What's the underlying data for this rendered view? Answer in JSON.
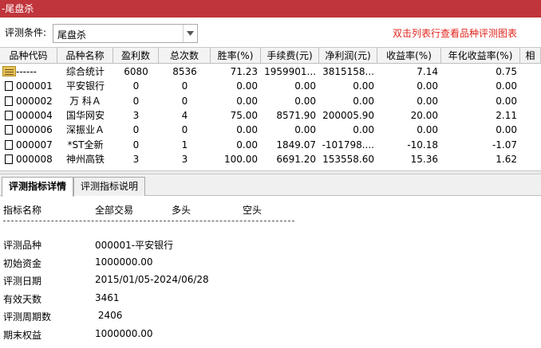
{
  "window": {
    "title": "-尾盘杀"
  },
  "toolbar": {
    "condition_label": "评测条件:",
    "condition_value": "尾盘杀",
    "hint": "双击列表行查看品种评测图表"
  },
  "table": {
    "columns": [
      "品种代码",
      "品种名称",
      "盈利数",
      "总次数",
      "胜率(%)",
      "手续费(元)",
      "净利润(元)",
      "收益率(%)",
      "年化收益率(%)",
      "相"
    ],
    "rows": [
      {
        "code": "------",
        "name": "综合统计",
        "wins": "6080",
        "total": "8536",
        "winrate": "71.23",
        "fee": "1959901...",
        "profit": "3815158...",
        "ret": "7.14",
        "annual": "0.75",
        "summary": true
      },
      {
        "code": "000001",
        "name": "平安银行",
        "wins": "0",
        "total": "0",
        "winrate": "0.00",
        "fee": "0.00",
        "profit": "0.00",
        "ret": "0.00",
        "annual": "0.00"
      },
      {
        "code": "000002",
        "name": "万 科Ａ",
        "wins": "0",
        "total": "0",
        "winrate": "0.00",
        "fee": "0.00",
        "profit": "0.00",
        "ret": "0.00",
        "annual": "0.00"
      },
      {
        "code": "000004",
        "name": "国华网安",
        "wins": "3",
        "total": "4",
        "winrate": "75.00",
        "fee": "8571.90",
        "profit": "200005.90",
        "ret": "20.00",
        "annual": "2.11"
      },
      {
        "code": "000006",
        "name": "深振业Ａ",
        "wins": "0",
        "total": "0",
        "winrate": "0.00",
        "fee": "0.00",
        "profit": "0.00",
        "ret": "0.00",
        "annual": "0.00"
      },
      {
        "code": "000007",
        "name": "*ST全新",
        "wins": "0",
        "total": "1",
        "winrate": "0.00",
        "fee": "1849.07",
        "profit": "-101798....",
        "ret": "-10.18",
        "annual": "-1.07"
      },
      {
        "code": "000008",
        "name": "神州高铁",
        "wins": "3",
        "total": "3",
        "winrate": "100.00",
        "fee": "6691.20",
        "profit": "153558.60",
        "ret": "15.36",
        "annual": "1.62"
      }
    ]
  },
  "tabs": [
    {
      "label": "评测指标详情",
      "active": true
    },
    {
      "label": "评测指标说明",
      "active": false
    }
  ],
  "detail": {
    "headers": [
      "指标名称",
      "全部交易",
      "多头",
      "空头"
    ],
    "rows": [
      {
        "label": "评测品种",
        "value": "000001-平安银行"
      },
      {
        "label": "初始资金",
        "value": "1000000.00"
      },
      {
        "label": "评测日期",
        "value": "2015/01/05-2024/06/28"
      },
      {
        "label": "有效天数",
        "value": "3461"
      },
      {
        "label": "评测周期数",
        "value": " 2406"
      },
      {
        "label": "期末权益",
        "value": "1000000.00"
      }
    ]
  }
}
